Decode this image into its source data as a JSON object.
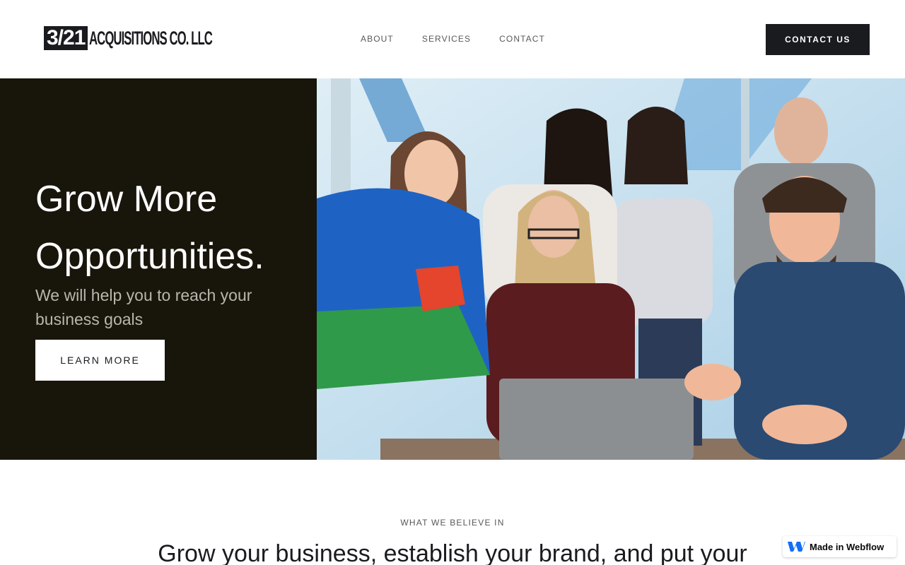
{
  "header": {
    "logo": {
      "mark": "3/21",
      "text": "ACQUISITIONS CO. LLC"
    },
    "nav": [
      {
        "label": "ABOUT"
      },
      {
        "label": "SERVICES"
      },
      {
        "label": "CONTACT"
      }
    ],
    "cta_label": "CONTACT US"
  },
  "hero": {
    "title_line1": "Grow More",
    "title_line2": "Opportunities.",
    "subtitle": "We will help you to reach your business goals",
    "button_label": "LEARN MORE",
    "image_icon": "team-photo"
  },
  "section": {
    "eyebrow": "WHAT WE BELIEVE IN",
    "heading": "Grow your business, establish your brand, and put your"
  },
  "badge": {
    "label": "Made in Webflow",
    "icon": "webflow-icon"
  },
  "colors": {
    "dark": "#1a1b1f",
    "hero_bg": "#18150b",
    "accent_blue": "#146ef5"
  }
}
